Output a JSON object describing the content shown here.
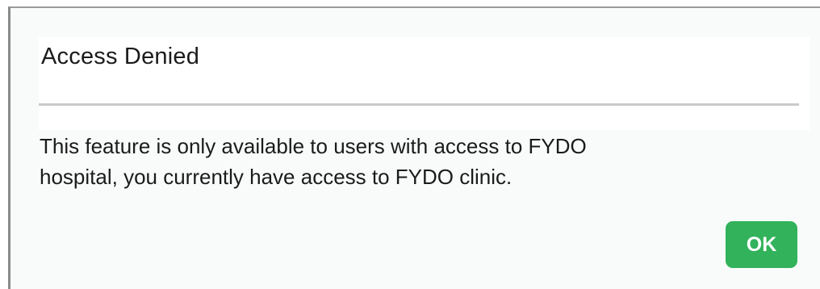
{
  "dialog": {
    "title": "Access Denied",
    "message_lines": [
      "This feature is only available to users with access to FYDO",
      "hospital, you currently have access to FYDO clinic."
    ],
    "ok_label": "OK"
  },
  "colors": {
    "ok_button_bg": "#31b25b",
    "divider": "#c9c9c9",
    "text": "#1b1b1b"
  }
}
